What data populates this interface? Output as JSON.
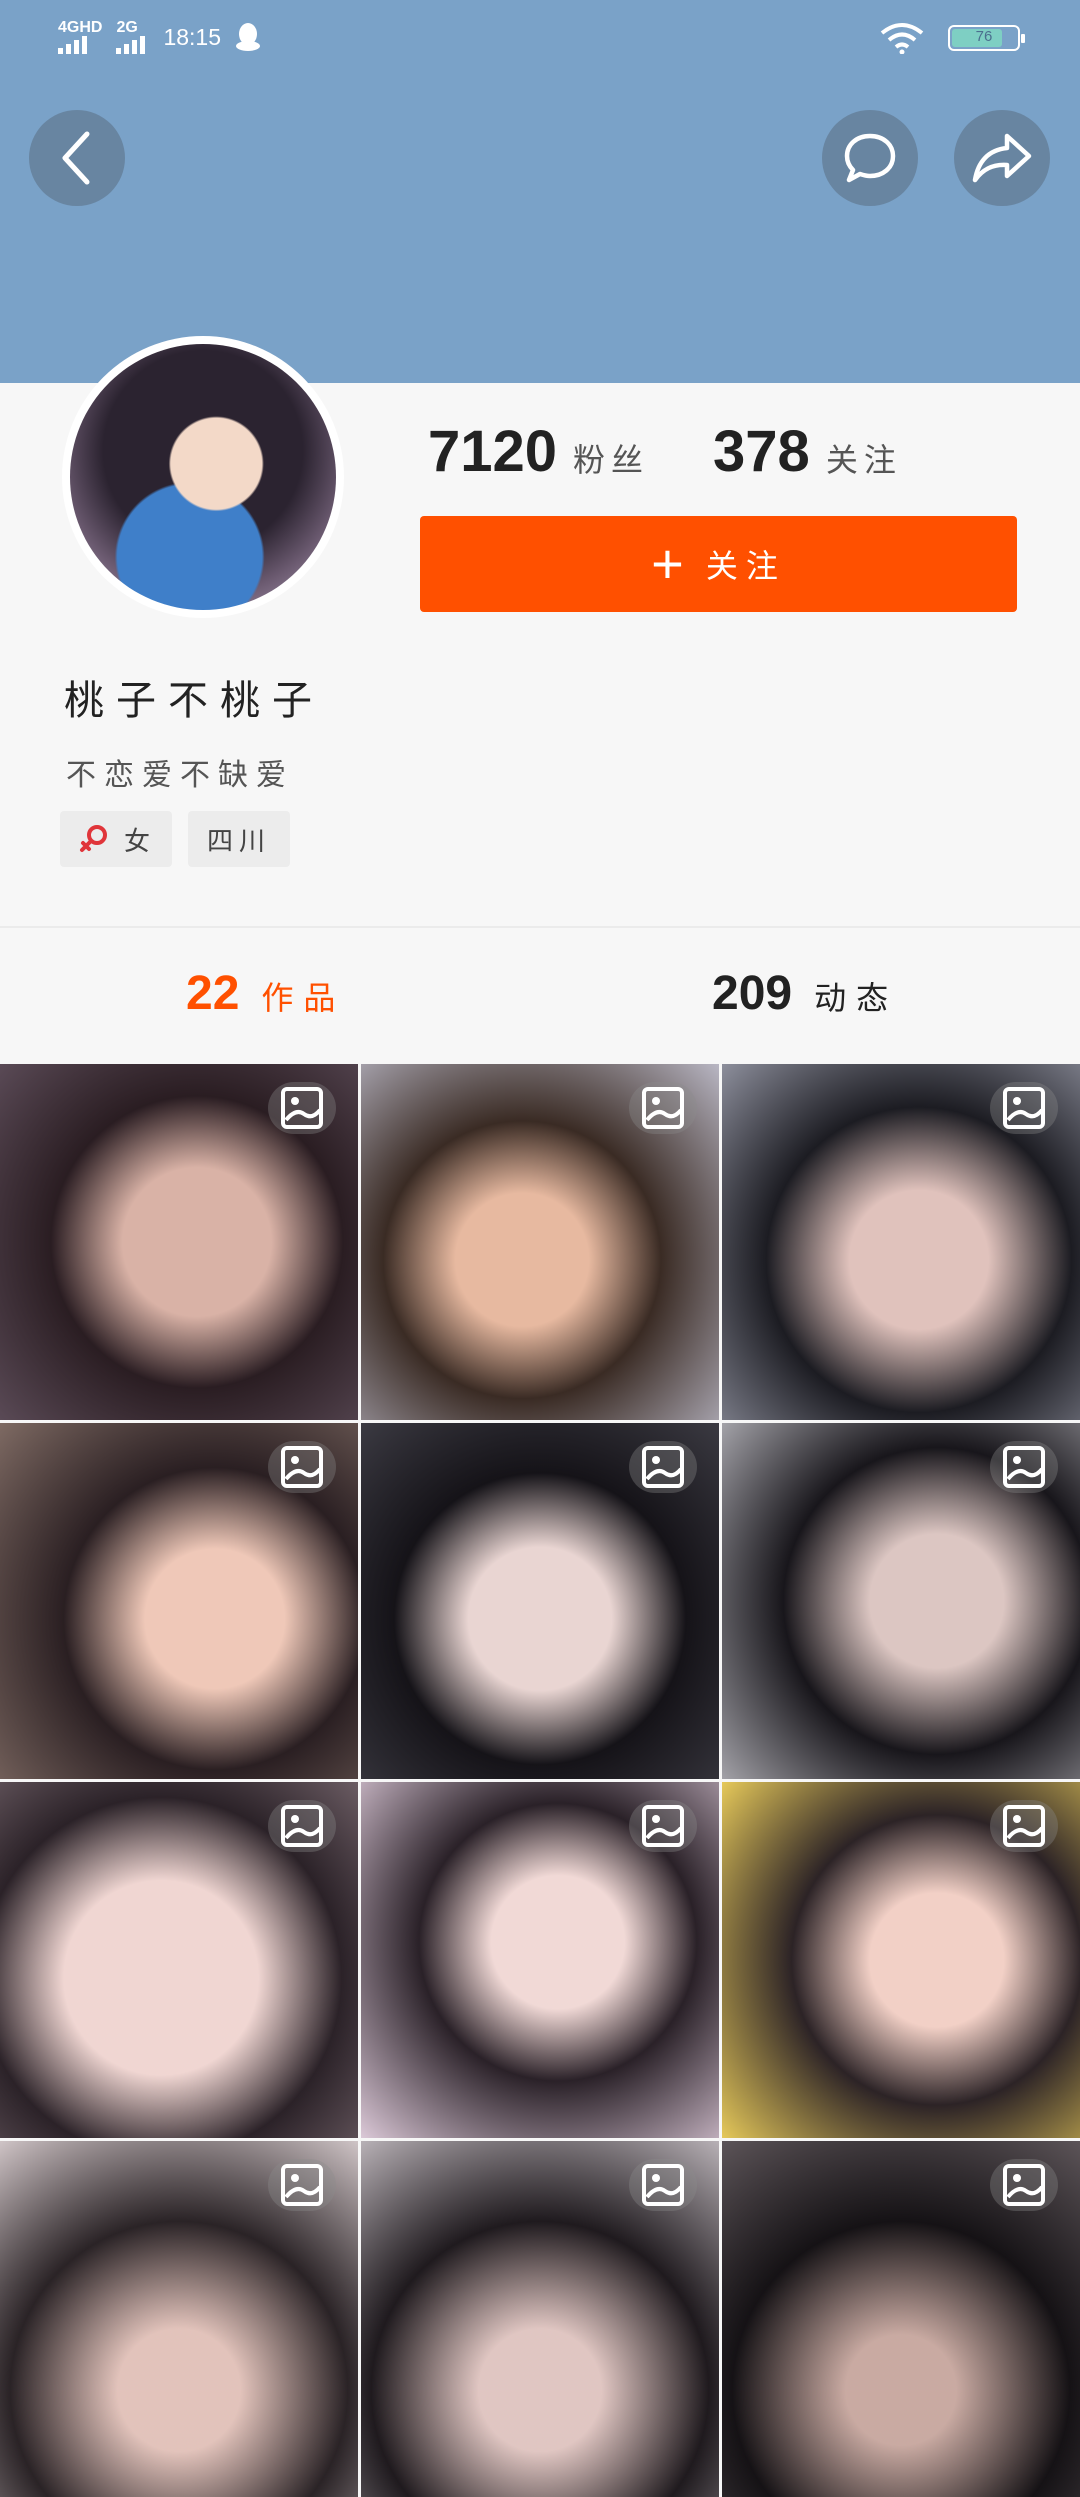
{
  "status_bar": {
    "network1": "4GHD",
    "network2": "2G",
    "time": "18:15",
    "battery": "76"
  },
  "header": {
    "back_icon": "chevron-left-icon",
    "message_icon": "chat-bubble-icon",
    "share_icon": "share-arrow-icon"
  },
  "profile": {
    "followers_count": "7120",
    "followers_label": "粉丝",
    "following_count": "378",
    "following_label": "关注",
    "follow_button_label": "关注",
    "username": "桃子不桃子",
    "bio": "不恋爱不缺爱",
    "gender_label": "女",
    "region": "四川"
  },
  "tabs": {
    "works_count": "22",
    "works_label": "作品",
    "moments_count": "209",
    "moments_label": "动态"
  },
  "colors": {
    "banner": "#7aa2c8",
    "accent": "#ff5000"
  },
  "grid": {
    "item_icon": "image-post-icon",
    "items": 12
  }
}
